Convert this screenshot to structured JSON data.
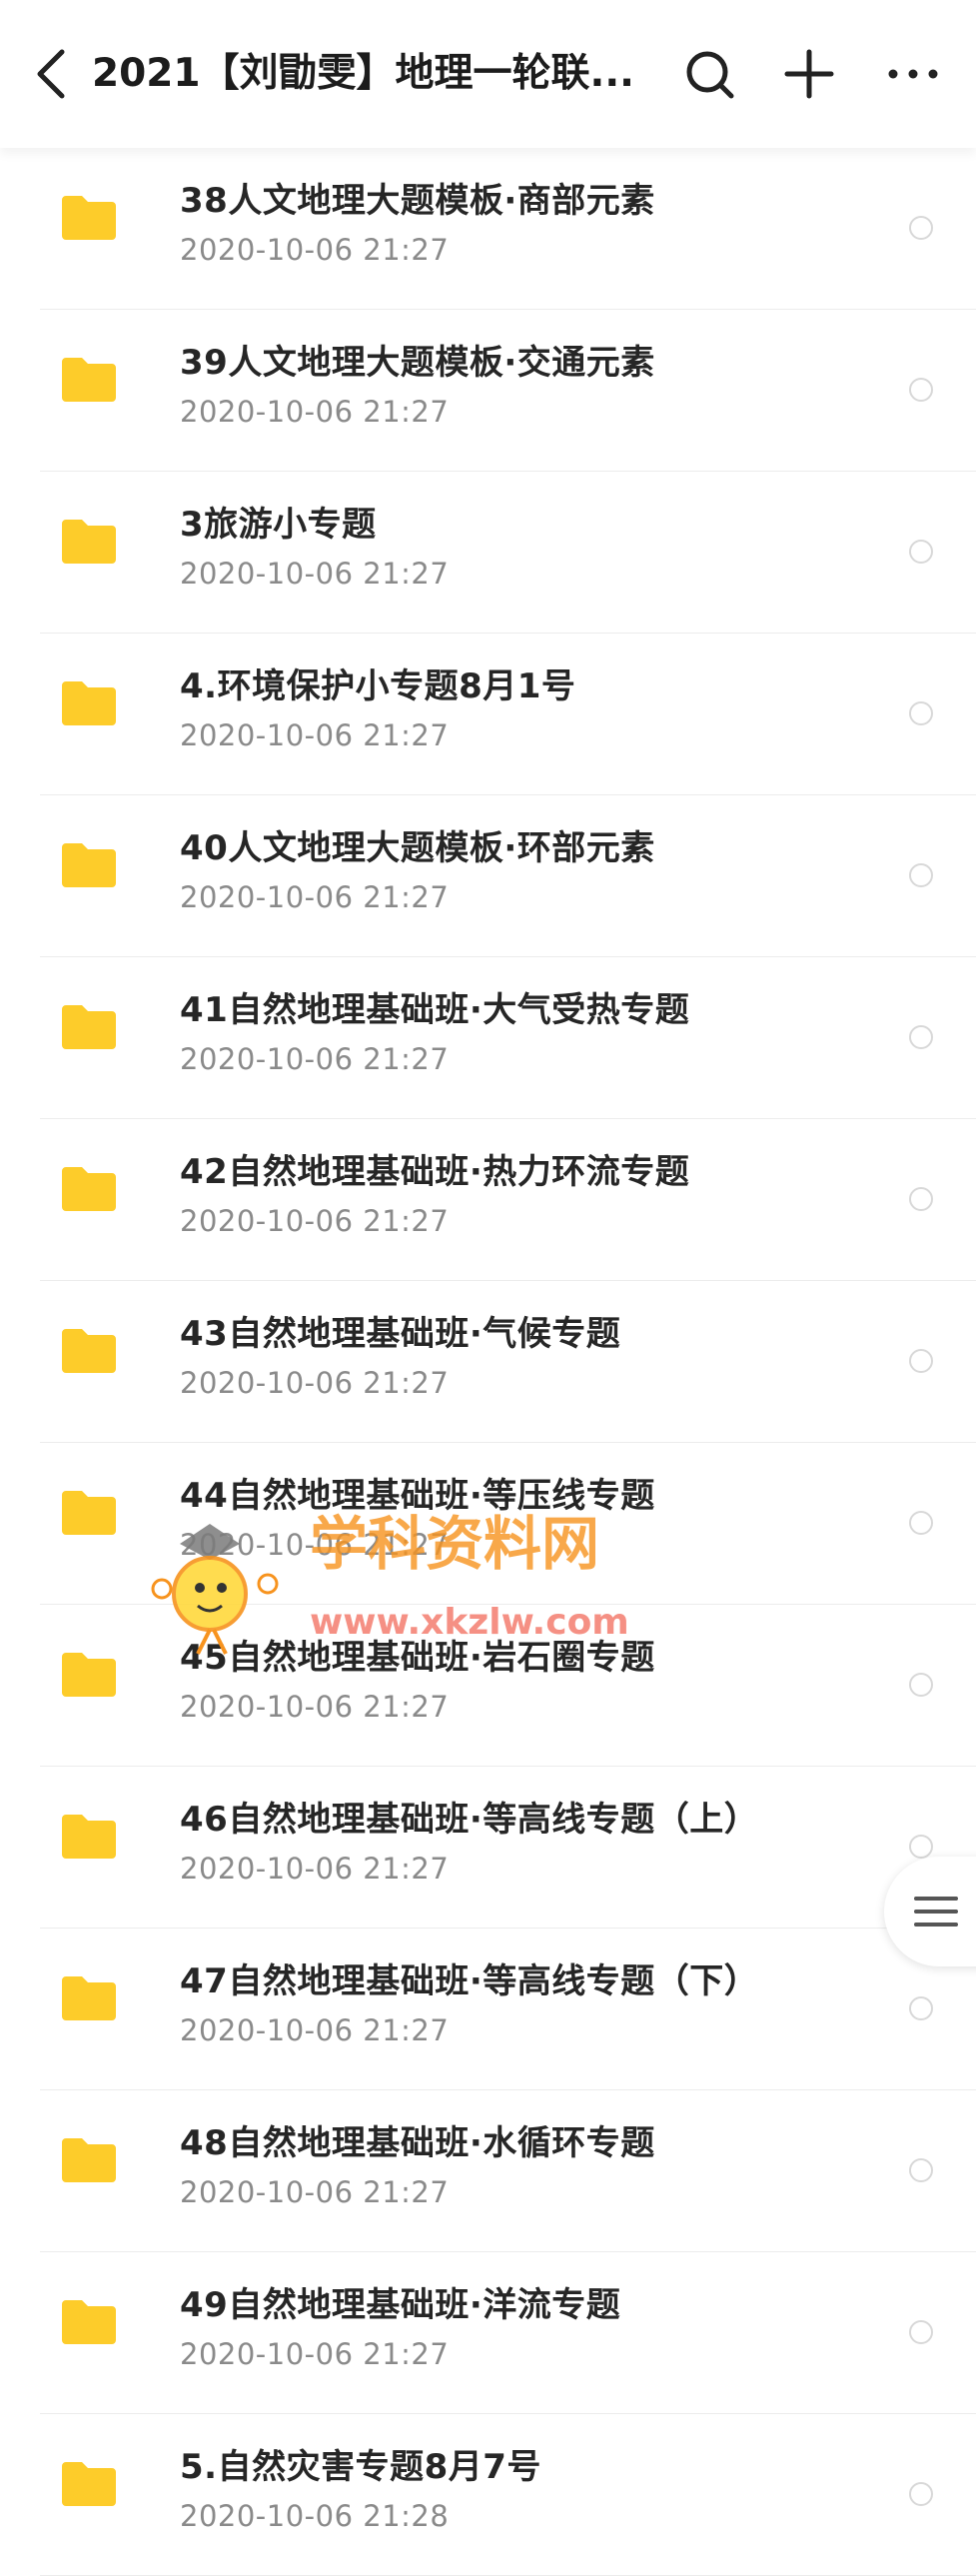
{
  "header": {
    "title": "2021【刘勖雯】地理一轮联..."
  },
  "icons": {
    "back": "chevron-left-icon",
    "search": "search-icon",
    "add": "plus-icon",
    "more": "more-icon",
    "folder": "folder-icon",
    "select": "radio-icon",
    "menu": "menu-icon"
  },
  "colors": {
    "folder": "#FDCC2A",
    "watermark_orange": "#F7931E",
    "watermark_green": "#8CC63F"
  },
  "files": [
    {
      "name": "38人文地理大题模板·商部元素",
      "date": "2020-10-06  21:27"
    },
    {
      "name": "39人文地理大题模板·交通元素",
      "date": "2020-10-06  21:27"
    },
    {
      "name": "3旅游小专题",
      "date": "2020-10-06  21:27"
    },
    {
      "name": "4.环境保护小专题8月1号",
      "date": "2020-10-06  21:27"
    },
    {
      "name": "40人文地理大题模板·环部元素",
      "date": "2020-10-06  21:27"
    },
    {
      "name": "41自然地理基础班·大气受热专题",
      "date": "2020-10-06  21:27"
    },
    {
      "name": "42自然地理基础班·热力环流专题",
      "date": "2020-10-06  21:27"
    },
    {
      "name": "43自然地理基础班·气候专题",
      "date": "2020-10-06  21:27"
    },
    {
      "name": "44自然地理基础班·等压线专题",
      "date": "2020-10-06  21:27"
    },
    {
      "name": "45自然地理基础班·岩石圈专题",
      "date": "2020-10-06  21:27"
    },
    {
      "name": "46自然地理基础班·等高线专题（上）",
      "date": "2020-10-06  21:27"
    },
    {
      "name": "47自然地理基础班·等高线专题（下）",
      "date": "2020-10-06  21:27"
    },
    {
      "name": "48自然地理基础班·水循环专题",
      "date": "2020-10-06  21:27"
    },
    {
      "name": "49自然地理基础班·洋流专题",
      "date": "2020-10-06  21:27"
    },
    {
      "name": "5.自然灾害专题8月7号",
      "date": "2020-10-06  21:28"
    }
  ],
  "watermark": {
    "title": "学科资料网",
    "url": "www.xkzlw.com"
  }
}
